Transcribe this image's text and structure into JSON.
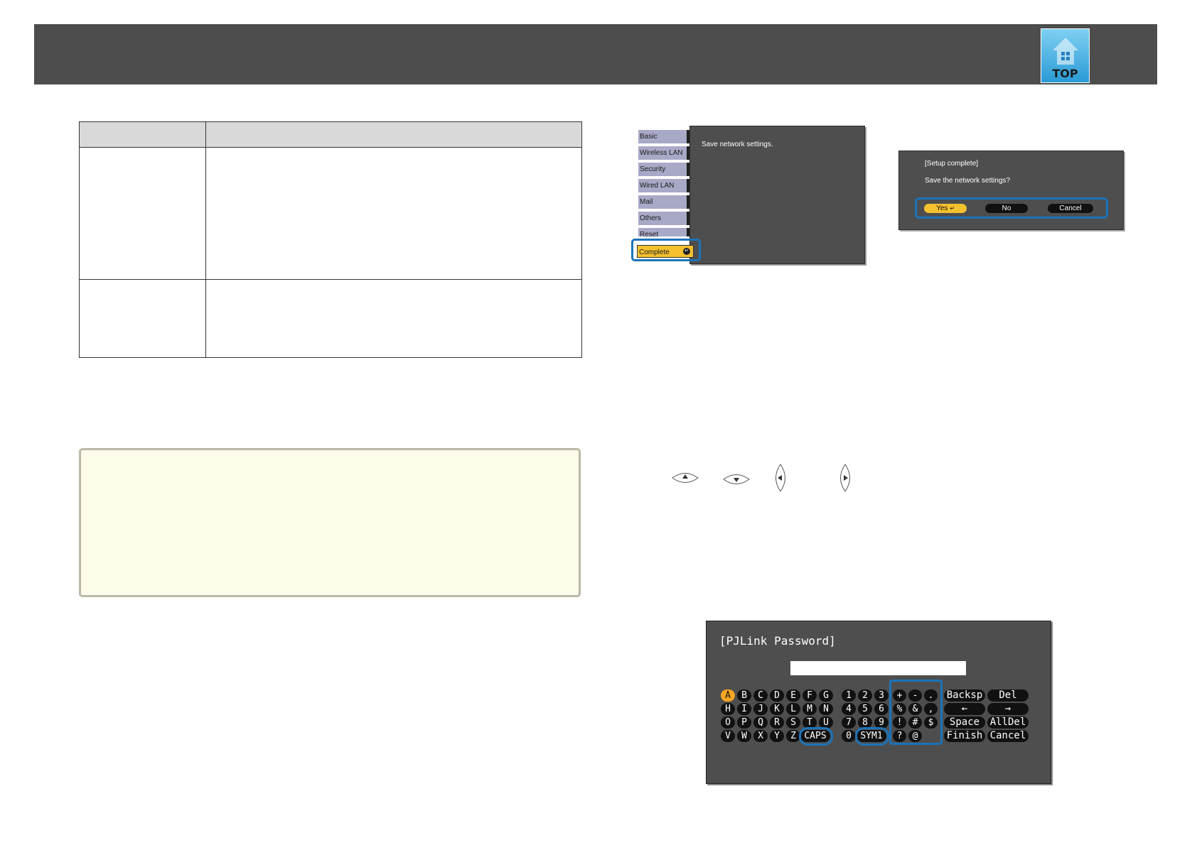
{
  "header": {
    "logo_text": "TOP",
    "logo_icon": "home-icon"
  },
  "menu": {
    "message": "Save network settings.",
    "tabs": [
      "Basic",
      "Wireless LAN",
      "Security",
      "Wired LAN",
      "Mail",
      "Others",
      "Reset"
    ],
    "active_tab": "Complete"
  },
  "dialog": {
    "title": "[Setup complete]",
    "message": "Save the network settings?",
    "buttons": {
      "yes": "Yes",
      "no": "No",
      "cancel": "Cancel"
    }
  },
  "remote_buttons": [
    "up-arrow-button",
    "down-arrow-button",
    "left-arrow-button",
    "right-arrow-button"
  ],
  "keyboard": {
    "title": "[PJLink Password]",
    "input_value": "",
    "letter_rows": [
      [
        "A",
        "B",
        "C",
        "D",
        "E",
        "F",
        "G"
      ],
      [
        "H",
        "I",
        "J",
        "K",
        "L",
        "M",
        "N"
      ],
      [
        "O",
        "P",
        "Q",
        "R",
        "S",
        "T",
        "U"
      ],
      [
        "V",
        "W",
        "X",
        "Y",
        "Z"
      ]
    ],
    "caps_label": "CAPS",
    "digit_rows": [
      [
        "1",
        "2",
        "3"
      ],
      [
        "4",
        "5",
        "6"
      ],
      [
        "7",
        "8",
        "9"
      ],
      [
        "0"
      ]
    ],
    "sym_label": "SYM1",
    "symbol_rows": [
      [
        "+",
        "-",
        "."
      ],
      [
        "%",
        "&",
        ","
      ],
      [
        "!",
        "#",
        "$"
      ],
      [
        "?",
        "@"
      ]
    ],
    "function_keys": [
      [
        "Backsp",
        "Del"
      ],
      [
        "←",
        "→"
      ],
      [
        "Space",
        "AllDel"
      ],
      [
        "Finish",
        "Cancel"
      ]
    ]
  },
  "colors": {
    "header_bg": "#4d4d4d",
    "highlight": "#1b73b8",
    "selected": "#f5c12f",
    "note_bg": "#fdfbea"
  }
}
